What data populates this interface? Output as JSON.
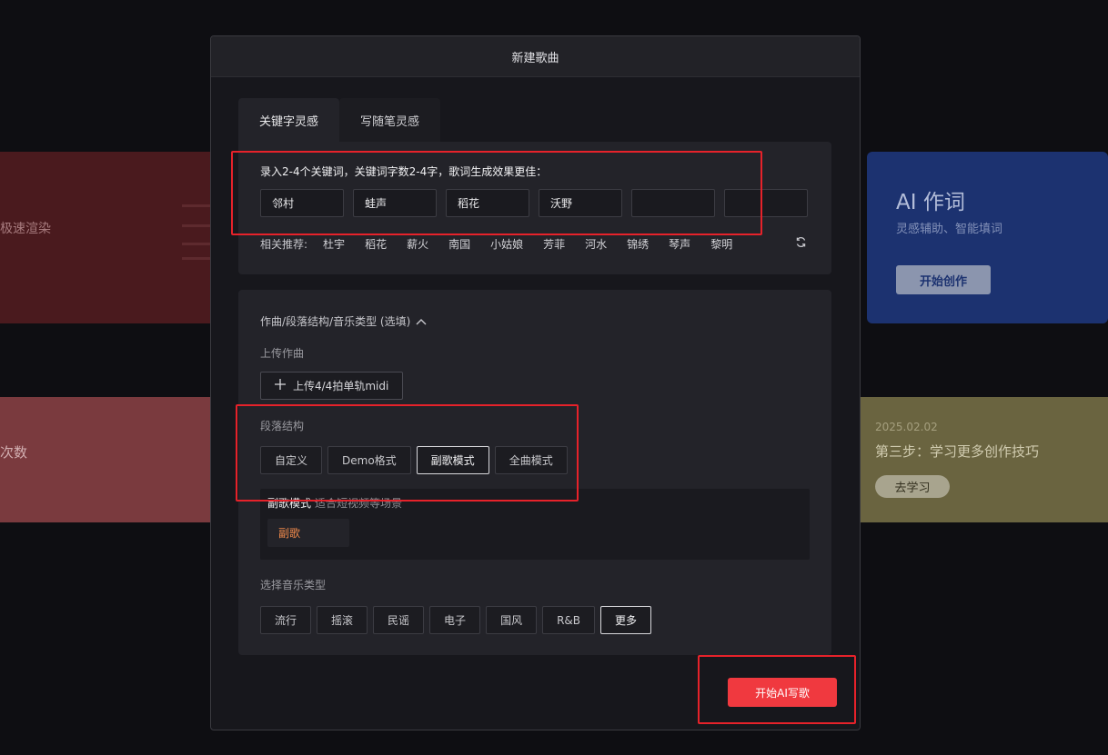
{
  "background": {
    "red_card_text": "极速渲染",
    "pink_card_text": "次数",
    "blue_card": {
      "title": "AI 作词",
      "subtitle": "灵感辅助、智能填词",
      "button": "开始创作"
    },
    "olive_card": {
      "date": "2025.02.02",
      "title": "第三步：学习更多创作技巧",
      "button": "去学习"
    }
  },
  "modal": {
    "title": "新建歌曲",
    "tabs": [
      {
        "label": "关键字灵感",
        "active": true
      },
      {
        "label": "写随笔灵感",
        "active": false
      }
    ],
    "keywords": {
      "hint": "录入2-4个关键词，关键词字数2-4字，歌词生成效果更佳：",
      "values": [
        "邻村",
        "蛙声",
        "稻花",
        "沃野",
        "",
        ""
      ]
    },
    "recommend": {
      "label": "相关推荐:",
      "items": [
        "杜宇",
        "稻花",
        "薪火",
        "南国",
        "小姑娘",
        "芳菲",
        "河水",
        "锦绣",
        "琴声",
        "黎明"
      ]
    },
    "options": {
      "toggle_label": "作曲/段落结构/音乐类型 (选填)",
      "upload_label": "上传作曲",
      "upload_button": "上传4/4拍单轨midi",
      "structure_label": "段落结构",
      "structure_options": [
        "自定义",
        "Demo格式",
        "副歌模式",
        "全曲模式"
      ],
      "structure_selected": "副歌模式",
      "mode_title": "副歌模式",
      "mode_desc": "适合短视频等场景",
      "mode_chip": "副歌",
      "genre_label": "选择音乐类型",
      "genres": [
        "流行",
        "摇滚",
        "民谣",
        "电子",
        "国风",
        "R&B",
        "更多"
      ]
    },
    "submit": "开始AI写歌"
  },
  "colors": {
    "accent": "#f0393f",
    "annotation": "#e6222a",
    "chip_text": "#f08a4b"
  }
}
